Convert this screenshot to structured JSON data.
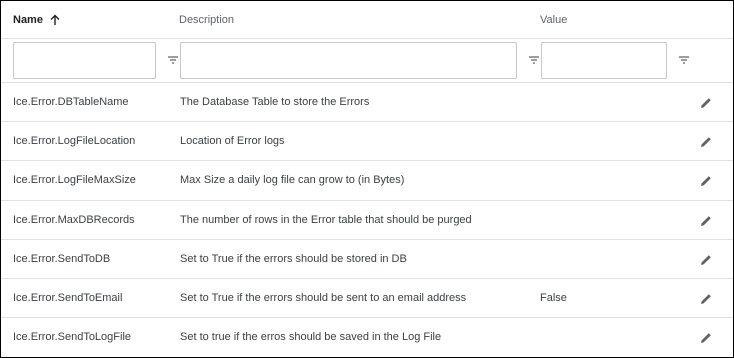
{
  "columns": {
    "name": "Name",
    "description": "Description",
    "value": "Value"
  },
  "sort": {
    "column": "Name",
    "direction": "ascending",
    "icon": "arrow-up-icon"
  },
  "filters": {
    "name_value": "",
    "description_value": "",
    "value_value": "",
    "icon": "filter-icon"
  },
  "edit_icon": "pencil-icon",
  "rows": [
    {
      "name": "Ice.Error.DBTableName",
      "description": "The Database Table to store the Errors",
      "value": ""
    },
    {
      "name": "Ice.Error.LogFileLocation",
      "description": "Location of Error logs",
      "value": ""
    },
    {
      "name": "Ice.Error.LogFileMaxSize",
      "description": "Max Size a daily log file can grow to (in Bytes)",
      "value": ""
    },
    {
      "name": "Ice.Error.MaxDBRecords",
      "description": "The number of rows in the Error table that should be purged",
      "value": ""
    },
    {
      "name": "Ice.Error.SendToDB",
      "description": "Set to True if the errors should be stored in DB",
      "value": ""
    },
    {
      "name": "Ice.Error.SendToEmail",
      "description": "Set to True if the errors should be sent to an email address",
      "value": "False"
    },
    {
      "name": "Ice.Error.SendToLogFile",
      "description": "Set to true if the erros should be saved in the Log File",
      "value": ""
    }
  ],
  "colors": {
    "text": "#3c4043",
    "header_text": "#5f6368",
    "border": "#e0e0e0",
    "icon": "#5f6368"
  }
}
